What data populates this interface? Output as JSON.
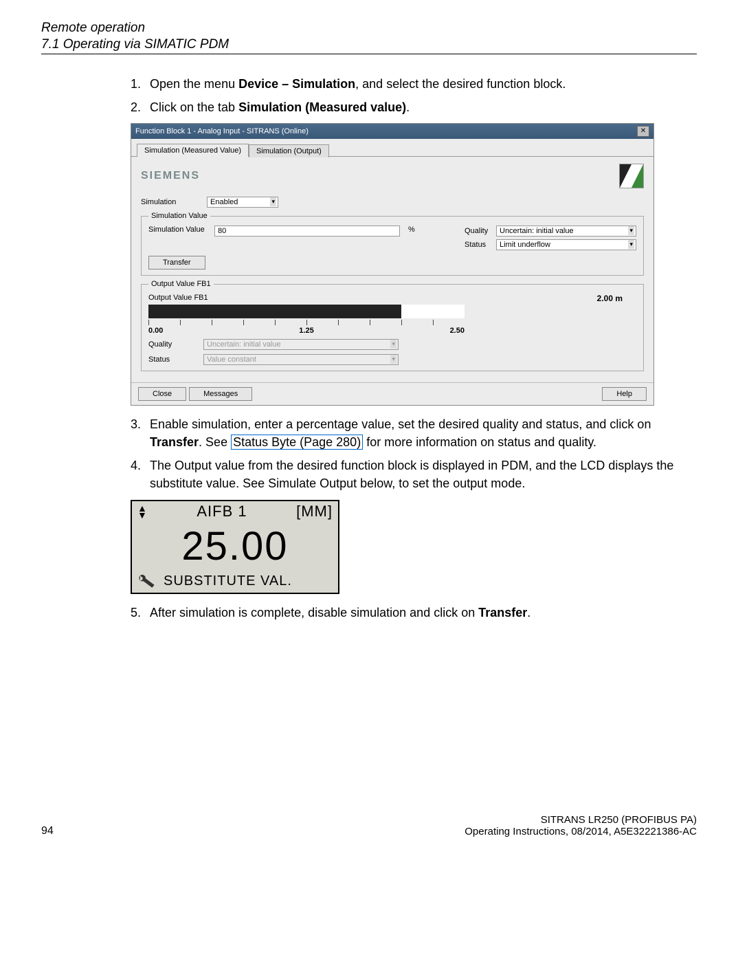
{
  "header": {
    "title": "Remote operation",
    "subtitle": "7.1 Operating via SIMATIC PDM"
  },
  "steps": {
    "s1": {
      "num": "1.",
      "pre": "Open the menu ",
      "bold": "Device – Simulation",
      "post": ", and select the desired function block."
    },
    "s2": {
      "num": "2.",
      "pre": "Click on the tab ",
      "bold": "Simulation (Measured value)",
      "post": "."
    },
    "s3": {
      "num": "3.",
      "pre": "Enable simulation, enter a percentage value, set the desired quality and status, and click on ",
      "bold": "Transfer",
      "post_see": ". See ",
      "link": "Status Byte (Page 280)",
      "post2": " for more information on status and quality."
    },
    "s4": {
      "num": "4.",
      "text": "The Output value from the desired function block is displayed in PDM, and the LCD displays the substitute value. See Simulate Output below, to set the output mode."
    },
    "s5": {
      "num": "5.",
      "pre": "After simulation is complete, disable simulation and click on ",
      "bold": "Transfer",
      "post": "."
    }
  },
  "dialog": {
    "title": "Function Block 1 - Analog Input - SITRANS  (Online)",
    "tab_active": "Simulation (Measured Value)",
    "tab_inactive": "Simulation (Output)",
    "brand": "SIEMENS",
    "sim_label": "Simulation",
    "sim_value_dropdown": "Enabled",
    "fs_simvalue": "Simulation Value",
    "simvalue_label": "Simulation Value",
    "simvalue_input": "80",
    "pct": "%",
    "quality_label": "Quality",
    "quality_value": "Uncertain: initial value",
    "status_label": "Status",
    "status_value": "Limit underflow",
    "transfer_btn": "Transfer",
    "fs_output": "Output Value FB1",
    "output_label": "Output Value FB1",
    "bar_value": "2.00 m",
    "tick0": "0.00",
    "tick1": "1.25",
    "tick2": "2.50",
    "out_quality_label": "Quality",
    "out_quality_value": "Uncertain: initial value",
    "out_status_label": "Status",
    "out_status_value": "Value constant",
    "close_btn": "Close",
    "messages_btn": "Messages",
    "help_btn": "Help"
  },
  "lcd": {
    "fb": "AIFB 1",
    "unit": "[MM]",
    "value": "25.00",
    "status": "SUBSTITUTE VAL."
  },
  "footer": {
    "page": "94",
    "product": "SITRANS LR250 (PROFIBUS PA)",
    "doc": "Operating Instructions, 08/2014, A5E32221386-AC"
  }
}
